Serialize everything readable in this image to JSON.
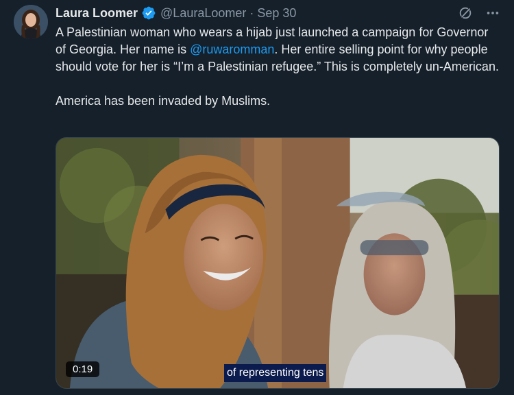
{
  "author": {
    "display_name": "Laura Loomer",
    "handle": "@LauraLoomer",
    "separator": "·",
    "date": "Sep 30",
    "verified": true,
    "avatar_icon": "profile-photo"
  },
  "tweet": {
    "text_before_mention": "A Palestinian woman who wears a hijab just launched a campaign for Governor of Georgia. Her name is ",
    "mention": "@ruwaromman",
    "text_after_mention": ". Her entire selling point for why people should vote for her is “I’m a Palestinian refugee.” This is completely un-American.",
    "paragraph_2": "America has been invaded by Muslims."
  },
  "actions": {
    "grok_icon": "grok-icon",
    "more_icon": "more-icon"
  },
  "video": {
    "duration": "0:19",
    "caption": "of representing tens"
  },
  "colors": {
    "background": "#15202b",
    "text": "#e7e9ea",
    "secondary": "#8b98a5",
    "link": "#1d9bf0",
    "verified": "#1d9bf0"
  }
}
